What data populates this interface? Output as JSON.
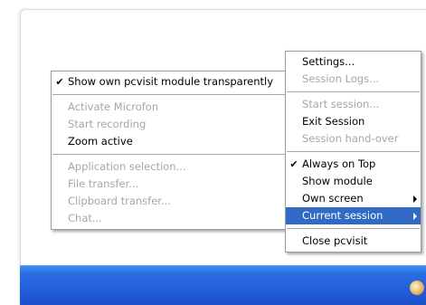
{
  "context_menu": {
    "items": [
      {
        "label": "Settings...",
        "enabled": true
      },
      {
        "label": "Session Logs...",
        "enabled": false
      },
      {
        "label": "Start session...",
        "enabled": false
      },
      {
        "label": "Exit Session",
        "enabled": true
      },
      {
        "label": "Session hand-over",
        "enabled": false
      },
      {
        "label": "Always on Top",
        "enabled": true,
        "checked": true
      },
      {
        "label": "Show module",
        "enabled": true
      },
      {
        "label": "Own screen",
        "enabled": true,
        "submenu": true
      },
      {
        "label": "Current session",
        "enabled": true,
        "submenu": true,
        "highlighted": true
      },
      {
        "label": "Close pcvisit",
        "enabled": true
      }
    ]
  },
  "submenu": {
    "items": [
      {
        "label": "Show own pcvisit module transparently",
        "enabled": true,
        "checked": true
      },
      {
        "label": "Activate Microfon",
        "enabled": false
      },
      {
        "label": "Start recording",
        "enabled": false
      },
      {
        "label": "Zoom active",
        "enabled": true
      },
      {
        "label": "Application selection...",
        "enabled": false
      },
      {
        "label": "File transfer...",
        "enabled": false
      },
      {
        "label": "Clipboard transfer...",
        "enabled": false
      },
      {
        "label": "Chat...",
        "enabled": false
      }
    ]
  },
  "colors": {
    "highlight": "#316ac5",
    "taskbar": "#245edb",
    "disabled_text": "#a6a6a6"
  },
  "icons": {
    "check": "checkmark-icon",
    "submenu_arrow": "submenu-arrow-icon",
    "tray": "pcvisit-tray-icon"
  }
}
